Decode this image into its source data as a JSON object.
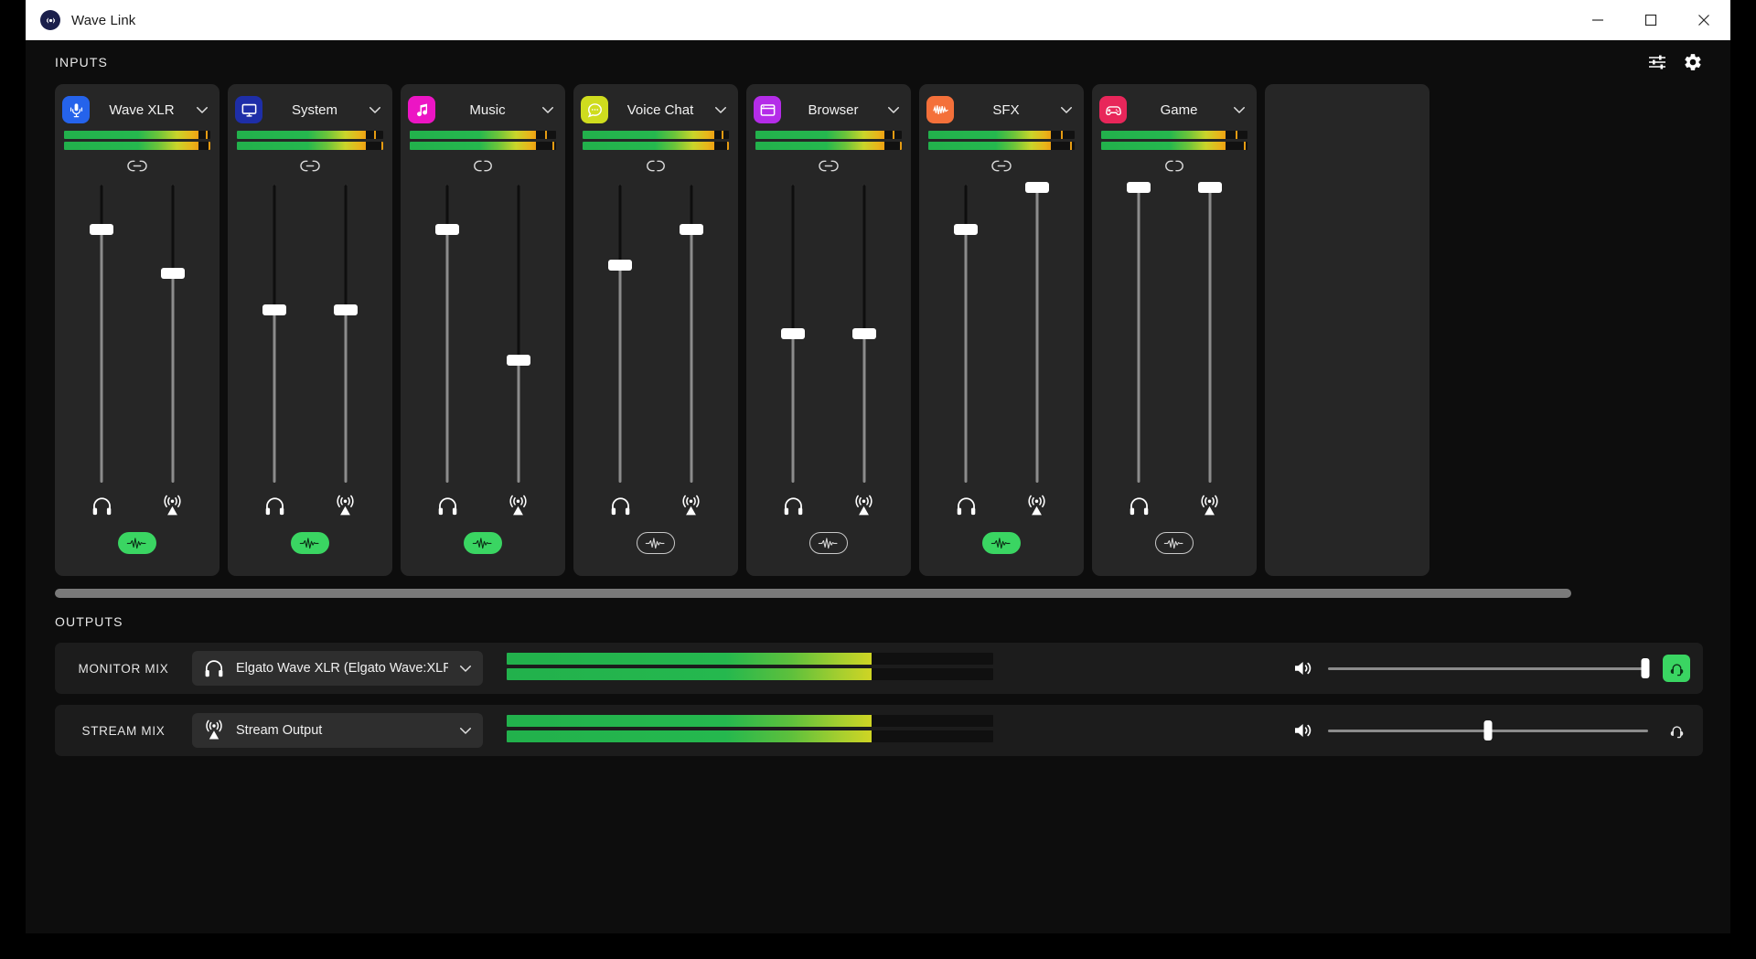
{
  "window": {
    "title": "Wave Link",
    "logo_icon": "wave-link-logo",
    "minimize_icon": "minimize-icon",
    "maximize_icon": "maximize-icon",
    "close_icon": "close-icon"
  },
  "inputs": {
    "section_label": "INPUTS",
    "mixer_view_icon": "mixer-sliders-icon",
    "settings_icon": "gear-icon",
    "scrollbar_thumb_percent": 92,
    "channels": [
      {
        "name": "Wave XLR",
        "icon": "microphone-icon",
        "icon_color": "#2563eb",
        "chevron_icon": "chevron-down-icon",
        "meters": [
          {
            "level_percent": 92,
            "peak_percent": 98
          },
          {
            "level_percent": 92,
            "peak_percent": 100
          }
        ],
        "link_icon": "link-connected-icon",
        "linked": true,
        "monitor_fader_percent": 85,
        "stream_fader_percent": 70,
        "headphone_icon": "headphone-icon",
        "broadcast_icon": "broadcast-icon",
        "mute_pill_icon": "waveform-icon",
        "mute_pill_active": true
      },
      {
        "name": "System",
        "icon": "monitor-icon",
        "icon_color": "#1e2ea8",
        "chevron_icon": "chevron-down-icon",
        "meters": [
          {
            "level_percent": 88,
            "peak_percent": 95
          },
          {
            "level_percent": 88,
            "peak_percent": 100
          }
        ],
        "link_icon": "link-connected-icon",
        "linked": true,
        "monitor_fader_percent": 58,
        "stream_fader_percent": 58,
        "headphone_icon": "headphone-icon",
        "broadcast_icon": "broadcast-icon",
        "mute_pill_icon": "waveform-icon",
        "mute_pill_active": true
      },
      {
        "name": "Music",
        "icon": "music-note-icon",
        "icon_color": "#ec15c4",
        "chevron_icon": "chevron-down-icon",
        "meters": [
          {
            "level_percent": 86,
            "peak_percent": 94
          },
          {
            "level_percent": 86,
            "peak_percent": 99
          }
        ],
        "link_icon": "link-broken-icon",
        "linked": false,
        "monitor_fader_percent": 85,
        "stream_fader_percent": 41,
        "headphone_icon": "headphone-icon",
        "broadcast_icon": "broadcast-icon",
        "mute_pill_icon": "waveform-icon",
        "mute_pill_active": true
      },
      {
        "name": "Voice Chat",
        "icon": "chat-bubble-icon",
        "icon_color": "#cfdc1e",
        "chevron_icon": "chevron-down-icon",
        "meters": [
          {
            "level_percent": 90,
            "peak_percent": 96
          },
          {
            "level_percent": 90,
            "peak_percent": 100
          }
        ],
        "link_icon": "link-broken-icon",
        "linked": false,
        "monitor_fader_percent": 73,
        "stream_fader_percent": 85,
        "headphone_icon": "headphone-icon",
        "broadcast_icon": "broadcast-icon",
        "mute_pill_icon": "waveform-icon",
        "mute_pill_active": false
      },
      {
        "name": "Browser",
        "icon": "browser-window-icon",
        "icon_color": "#b42ce8",
        "chevron_icon": "chevron-down-icon",
        "meters": [
          {
            "level_percent": 88,
            "peak_percent": 95
          },
          {
            "level_percent": 88,
            "peak_percent": 100
          }
        ],
        "link_icon": "link-connected-icon",
        "linked": true,
        "monitor_fader_percent": 50,
        "stream_fader_percent": 50,
        "headphone_icon": "headphone-icon",
        "broadcast_icon": "broadcast-icon",
        "mute_pill_icon": "waveform-icon",
        "mute_pill_active": false
      },
      {
        "name": "SFX",
        "icon": "waveform-square-icon",
        "icon_color": "#f4703a",
        "chevron_icon": "chevron-down-icon",
        "meters": [
          {
            "level_percent": 84,
            "peak_percent": 92
          },
          {
            "level_percent": 84,
            "peak_percent": 98
          }
        ],
        "link_icon": "link-connected-icon",
        "linked": true,
        "monitor_fader_percent": 85,
        "stream_fader_percent": 99,
        "headphone_icon": "headphone-icon",
        "broadcast_icon": "broadcast-icon",
        "mute_pill_icon": "waveform-icon",
        "mute_pill_active": true
      },
      {
        "name": "Game",
        "icon": "gamepad-icon",
        "icon_color": "#e8265a",
        "chevron_icon": "chevron-down-icon",
        "meters": [
          {
            "level_percent": 85,
            "peak_percent": 93
          },
          {
            "level_percent": 85,
            "peak_percent": 99
          }
        ],
        "link_icon": "link-broken-icon",
        "linked": false,
        "monitor_fader_percent": 99,
        "stream_fader_percent": 99,
        "headphone_icon": "headphone-icon",
        "broadcast_icon": "broadcast-icon",
        "mute_pill_icon": "waveform-icon",
        "mute_pill_active": false
      }
    ]
  },
  "outputs": {
    "section_label": "OUTPUTS",
    "rows": [
      {
        "label": "MONITOR MIX",
        "device_icon": "headphone-icon",
        "device_name": "Elgato Wave XLR (Elgato Wave:XLR)",
        "chevron_icon": "chevron-down-icon",
        "meters": [
          {
            "level_percent": 75
          },
          {
            "level_percent": 75
          }
        ],
        "volume_icon": "speaker-volume-icon",
        "volume_percent": 99,
        "end_button_icon": "headphone-monitor-icon",
        "end_button_active": true
      },
      {
        "label": "STREAM MIX",
        "device_icon": "broadcast-icon",
        "device_name": "Stream Output",
        "chevron_icon": "chevron-down-icon",
        "meters": [
          {
            "level_percent": 75
          },
          {
            "level_percent": 75
          }
        ],
        "volume_icon": "speaker-volume-icon",
        "volume_percent": 50,
        "end_button_icon": "headphone-monitor-icon",
        "end_button_active": false
      }
    ]
  }
}
